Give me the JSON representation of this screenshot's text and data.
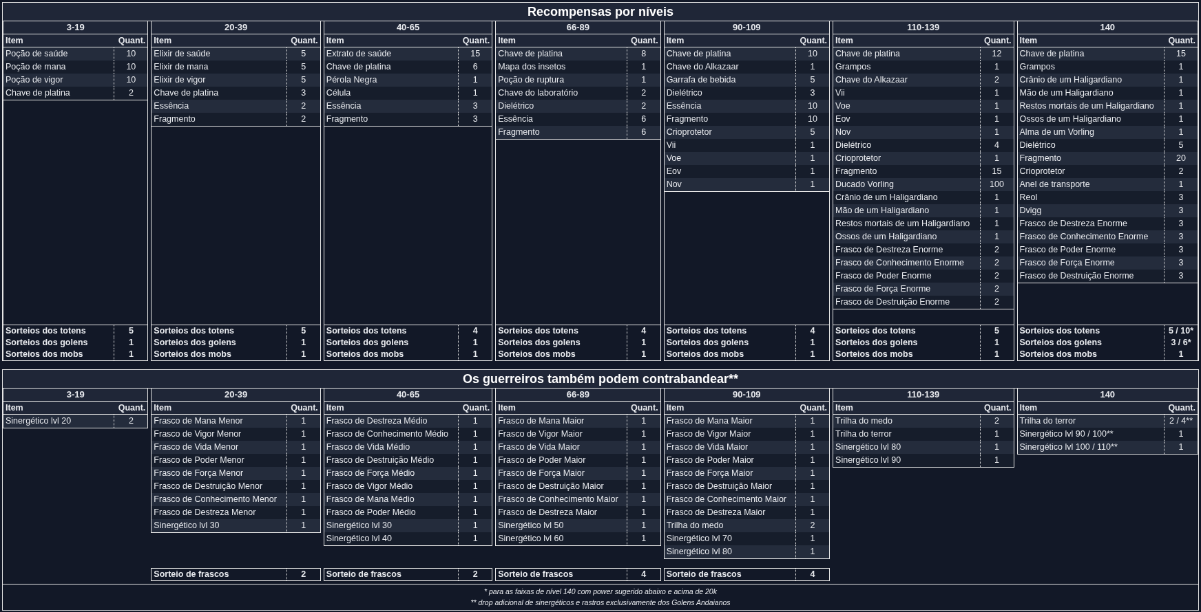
{
  "sections": [
    {
      "kind": "framed",
      "title": "Recompensas por níveis",
      "columns": [
        {
          "range": "3-19",
          "header": [
            "Item",
            "Quant."
          ],
          "rows": [
            {
              "item": "Poção de saúde",
              "qty": "10"
            },
            {
              "item": "Poção de mana",
              "qty": "10"
            },
            {
              "item": "Poção de vigor",
              "qty": "10"
            },
            {
              "item": "Chave de platina",
              "qty": "2"
            }
          ],
          "summary": [
            {
              "label": "Sorteios dos totens",
              "value": "5"
            },
            {
              "label": "Sorteios dos golens",
              "value": "1"
            },
            {
              "label": "Sorteios dos mobs",
              "value": "1"
            }
          ]
        },
        {
          "range": "20-39",
          "header": [
            "Item",
            "Quant."
          ],
          "rows": [
            {
              "item": "Elixir de saúde",
              "qty": "5"
            },
            {
              "item": "Elixir de mana",
              "qty": "5"
            },
            {
              "item": "Elixir de vigor",
              "qty": "5"
            },
            {
              "item": "Chave de platina",
              "qty": "3"
            },
            {
              "item": "Essência",
              "qty": "2"
            },
            {
              "item": "Fragmento",
              "qty": "2"
            }
          ],
          "summary": [
            {
              "label": "Sorteios dos totens",
              "value": "5"
            },
            {
              "label": "Sorteios dos golens",
              "value": "1"
            },
            {
              "label": "Sorteios dos mobs",
              "value": "1"
            }
          ]
        },
        {
          "range": "40-65",
          "header": [
            "Item",
            "Quant."
          ],
          "rows": [
            {
              "item": "Extrato de saúde",
              "qty": "15"
            },
            {
              "item": "Chave de platina",
              "qty": "6"
            },
            {
              "item": "Pérola Negra",
              "qty": "1"
            },
            {
              "item": "Célula",
              "qty": "1"
            },
            {
              "item": "Essência",
              "qty": "3"
            },
            {
              "item": "Fragmento",
              "qty": "3"
            }
          ],
          "summary": [
            {
              "label": "Sorteios dos totens",
              "value": "4"
            },
            {
              "label": "Sorteios dos golens",
              "value": "1"
            },
            {
              "label": "Sorteios dos mobs",
              "value": "1"
            }
          ]
        },
        {
          "range": "66-89",
          "header": [
            "Item",
            "Quant."
          ],
          "rows": [
            {
              "item": "Chave de platina",
              "qty": "8"
            },
            {
              "item": "Mapa dos insetos",
              "qty": "1"
            },
            {
              "item": "Poção de ruptura",
              "qty": "1"
            },
            {
              "item": "Chave do laboratório",
              "qty": "2"
            },
            {
              "item": "Dielétrico",
              "qty": "2"
            },
            {
              "item": "Essência",
              "qty": "6"
            },
            {
              "item": "Fragmento",
              "qty": "6"
            }
          ],
          "summary": [
            {
              "label": "Sorteios dos totens",
              "value": "4"
            },
            {
              "label": "Sorteios dos golens",
              "value": "1"
            },
            {
              "label": "Sorteios dos mobs",
              "value": "1"
            }
          ]
        },
        {
          "range": "90-109",
          "header": [
            "Item",
            "Quant."
          ],
          "rows": [
            {
              "item": "Chave de platina",
              "qty": "10"
            },
            {
              "item": "Chave do Alkazaar",
              "qty": "1"
            },
            {
              "item": "Garrafa de bebida",
              "qty": "5"
            },
            {
              "item": "Dielétrico",
              "qty": "3"
            },
            {
              "item": "Essência",
              "qty": "10"
            },
            {
              "item": "Fragmento",
              "qty": "10"
            },
            {
              "item": "Crioprotetor",
              "qty": "5"
            },
            {
              "item": "Vii",
              "qty": "1"
            },
            {
              "item": "Voe",
              "qty": "1"
            },
            {
              "item": "Eov",
              "qty": "1"
            },
            {
              "item": "Nov",
              "qty": "1"
            }
          ],
          "summary": [
            {
              "label": "Sorteios dos totens",
              "value": "4"
            },
            {
              "label": "Sorteios dos golens",
              "value": "1"
            },
            {
              "label": "Sorteios dos mobs",
              "value": "1"
            }
          ]
        },
        {
          "range": "110-139",
          "header": [
            "Item",
            "Quant."
          ],
          "rows": [
            {
              "item": "Chave de platina",
              "qty": "12"
            },
            {
              "item": "Grampos",
              "qty": "1"
            },
            {
              "item": "Chave do Alkazaar",
              "qty": "2"
            },
            {
              "item": "Vii",
              "qty": "1"
            },
            {
              "item": "Voe",
              "qty": "1"
            },
            {
              "item": "Eov",
              "qty": "1"
            },
            {
              "item": "Nov",
              "qty": "1"
            },
            {
              "item": "Dielétrico",
              "qty": "4"
            },
            {
              "item": "Crioprotetor",
              "qty": "1"
            },
            {
              "item": "Fragmento",
              "qty": "15"
            },
            {
              "item": "Ducado Vorling",
              "qty": "100"
            },
            {
              "item": "Crânio de um Haligardiano",
              "qty": "1"
            },
            {
              "item": "Mão de um Haligardiano",
              "qty": "1"
            },
            {
              "item": "Restos mortais de um Haligardiano",
              "qty": "1"
            },
            {
              "item": "Ossos de um Haligardiano",
              "qty": "1"
            },
            {
              "item": "Frasco de Destreza Enorme",
              "qty": "2"
            },
            {
              "item": "Frasco de Conhecimento Enorme",
              "qty": "2"
            },
            {
              "item": "Frasco de Poder Enorme",
              "qty": "2"
            },
            {
              "item": "Frasco de Força Enorme",
              "qty": "2"
            },
            {
              "item": "Frasco de Destruição Enorme",
              "qty": "2"
            }
          ],
          "summary": [
            {
              "label": "Sorteios dos totens",
              "value": "5"
            },
            {
              "label": "Sorteios dos golens",
              "value": "1"
            },
            {
              "label": "Sorteios dos mobs",
              "value": "1"
            }
          ]
        },
        {
          "range": "140",
          "header": [
            "Item",
            "Quant."
          ],
          "rows": [
            {
              "item": "Chave de platina",
              "qty": "15"
            },
            {
              "item": "Grampos",
              "qty": "1"
            },
            {
              "item": "Crânio de um Haligardiano",
              "qty": "1"
            },
            {
              "item": "Mão de um Haligardiano",
              "qty": "1"
            },
            {
              "item": "Restos mortais de um Haligardiano",
              "qty": "1"
            },
            {
              "item": "Ossos de um Haligardiano",
              "qty": "1"
            },
            {
              "item": "Alma de um Vorling",
              "qty": "1"
            },
            {
              "item": "Dielétrico",
              "qty": "5"
            },
            {
              "item": "Fragmento",
              "qty": "20"
            },
            {
              "item": "Crioprotetor",
              "qty": "2"
            },
            {
              "item": "Anel de transporte",
              "qty": "1"
            },
            {
              "item": "Reol",
              "qty": "3"
            },
            {
              "item": "Dvigg",
              "qty": "3"
            },
            {
              "item": "Frasco de Destreza Enorme",
              "qty": "3"
            },
            {
              "item": "Frasco de Conhecimento Enorme",
              "qty": "3"
            },
            {
              "item": "Frasco de Poder Enorme",
              "qty": "3"
            },
            {
              "item": "Frasco de Força Enorme",
              "qty": "3"
            },
            {
              "item": "Frasco de Destruição Enorme",
              "qty": "3"
            }
          ],
          "summary": [
            {
              "label": "Sorteios dos totens",
              "value": "5 / 10*"
            },
            {
              "label": "Sorteios dos golens",
              "value": "3 / 6*"
            },
            {
              "label": "Sorteios dos mobs",
              "value": "1"
            }
          ]
        }
      ]
    },
    {
      "kind": "open",
      "title": "Os guerreiros também podem contrabandear**",
      "columns": [
        {
          "range": "3-19",
          "header": [
            "Item",
            "Quant."
          ],
          "rows": [
            {
              "item": "Sinergético lvl 20",
              "qty": "2"
            }
          ]
        },
        {
          "range": "20-39",
          "header": [
            "Item",
            "Quant."
          ],
          "rows": [
            {
              "item": "Frasco de Mana Menor",
              "qty": "1"
            },
            {
              "item": "Frasco de Vigor Menor",
              "qty": "1"
            },
            {
              "item": "Frasco de Vida Menor",
              "qty": "1"
            },
            {
              "item": "Frasco de Poder Menor",
              "qty": "1"
            },
            {
              "item": "Frasco de Força Menor",
              "qty": "1"
            },
            {
              "item": "Frasco de Destruição Menor",
              "qty": "1"
            },
            {
              "item": "Frasco de Conhecimento Menor",
              "qty": "1"
            },
            {
              "item": "Frasco de Destreza Menor",
              "qty": "1"
            },
            {
              "item": "Sinergético lvl 30",
              "qty": "1"
            }
          ],
          "summary": [
            {
              "label": "Sorteio de frascos",
              "value": "2"
            }
          ]
        },
        {
          "range": "40-65",
          "header": [
            "Item",
            "Quant."
          ],
          "rows": [
            {
              "item": "Frasco de Destreza Médio",
              "qty": "1"
            },
            {
              "item": "Frasco de Conhecimento Médio",
              "qty": "1"
            },
            {
              "item": "Frasco de Vida Médio",
              "qty": "1"
            },
            {
              "item": "Frasco de Destruição Médio",
              "qty": "1"
            },
            {
              "item": "Frasco de Força Médio",
              "qty": "1"
            },
            {
              "item": "Frasco de Vigor Médio",
              "qty": "1"
            },
            {
              "item": "Frasco de Mana Médio",
              "qty": "1"
            },
            {
              "item": "Frasco de Poder Médio",
              "qty": "1"
            },
            {
              "item": "Sinergético lvl 30",
              "qty": "1"
            },
            {
              "item": "Sinergético lvl 40",
              "qty": "1"
            }
          ],
          "summary": [
            {
              "label": "Sorteio de frascos",
              "value": "2"
            }
          ]
        },
        {
          "range": "66-89",
          "header": [
            "Item",
            "Quant."
          ],
          "rows": [
            {
              "item": "Frasco de Mana Maior",
              "qty": "1"
            },
            {
              "item": "Frasco de Vigor Maior",
              "qty": "1"
            },
            {
              "item": "Frasco de Vida Maior",
              "qty": "1"
            },
            {
              "item": "Frasco de Poder Maior",
              "qty": "1"
            },
            {
              "item": "Frasco de Força Maior",
              "qty": "1"
            },
            {
              "item": "Frasco de Destruição Maior",
              "qty": "1"
            },
            {
              "item": "Frasco de Conhecimento Maior",
              "qty": "1"
            },
            {
              "item": "Frasco de Destreza Maior",
              "qty": "1"
            },
            {
              "item": "Sinergético lvl 50",
              "qty": "1"
            },
            {
              "item": "Sinergético lvl 60",
              "qty": "1"
            }
          ],
          "summary": [
            {
              "label": "Sorteio de frascos",
              "value": "4"
            }
          ]
        },
        {
          "range": "90-109",
          "header": [
            "Item",
            "Quant."
          ],
          "rows": [
            {
              "item": "Frasco de Mana Maior",
              "qty": "1"
            },
            {
              "item": "Frasco de Vigor Maior",
              "qty": "1"
            },
            {
              "item": "Frasco de Vida Maior",
              "qty": "1"
            },
            {
              "item": "Frasco de Poder Maior",
              "qty": "1"
            },
            {
              "item": "Frasco de Força Maior",
              "qty": "1"
            },
            {
              "item": "Frasco de Destruição Maior",
              "qty": "1"
            },
            {
              "item": "Frasco de Conhecimento Maior",
              "qty": "1"
            },
            {
              "item": "Frasco de Destreza Maior",
              "qty": "1"
            },
            {
              "item": "Trilha do medo",
              "qty": "2"
            },
            {
              "item": "Sinergético lvl 70",
              "qty": "1"
            },
            {
              "item": "Sinergético lvl 80",
              "qty": "1"
            }
          ],
          "summary": [
            {
              "label": "Sorteio de frascos",
              "value": "4"
            }
          ]
        },
        {
          "range": "110-139",
          "header": [
            "Item",
            "Quant."
          ],
          "rows": [
            {
              "item": "Trilha do medo",
              "qty": "2"
            },
            {
              "item": "Trilha do terror",
              "qty": "1"
            },
            {
              "item": "Sinergético lvl 80",
              "qty": "1"
            },
            {
              "item": "Sinergético lvl 90",
              "qty": "1"
            }
          ]
        },
        {
          "range": "140",
          "header": [
            "Item",
            "Quant."
          ],
          "rows": [
            {
              "item": "Trilha do terror",
              "qty": "2 / 4**"
            },
            {
              "item": "Sinergético lvl 90 / 100**",
              "qty": "1"
            },
            {
              "item": "Sinergético lvl 100 / 110**",
              "qty": "1"
            }
          ]
        }
      ],
      "footnotes": [
        "*  para as faixas de nível 140 com power sugerido abaixo e acima de 20k",
        "** drop adicional de sinergéticos e rastros exclusivamente dos Golens Andaianos"
      ]
    }
  ]
}
